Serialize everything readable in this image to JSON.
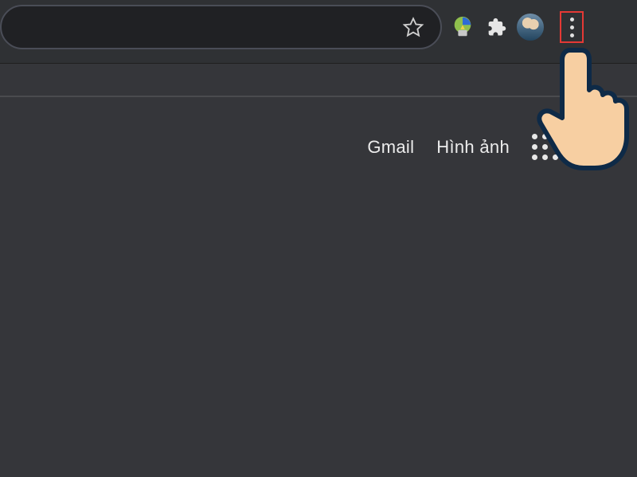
{
  "toolbar": {
    "bookmark_star": "star-icon",
    "extensions": {
      "idm": "idm-extension-icon",
      "puzzle": "extensions-icon"
    },
    "profile_avatar": "profile-avatar",
    "menu_kebab": "more-menu"
  },
  "google_header": {
    "gmail_label": "Gmail",
    "images_label": "Hình ảnh",
    "apps_grid": "google-apps-icon",
    "account_avatar": "account-avatar"
  },
  "annotation": {
    "highlight_target": "more-menu",
    "cursor_graphic": "pointing-hand"
  },
  "colors": {
    "bg": "#35363a",
    "toolbar": "#2f3134",
    "omnibox": "#202124",
    "text": "#ececec",
    "highlight_border": "#e53935"
  }
}
